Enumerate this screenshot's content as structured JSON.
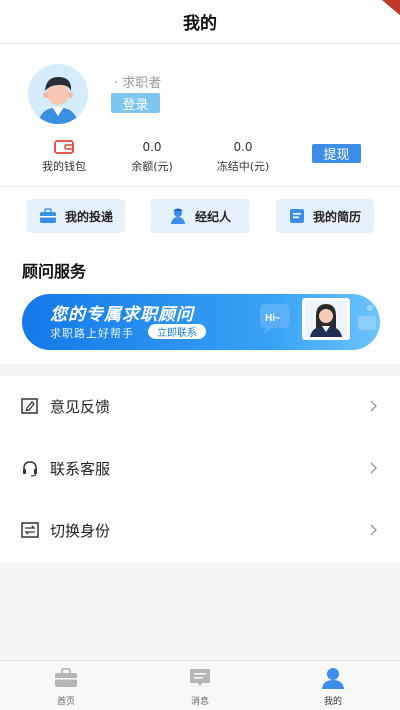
{
  "header": {
    "title": "我的"
  },
  "profile": {
    "role": "· 求职者",
    "login_label": "登录",
    "wallet_label": "我的钱包",
    "balance_value": "0.0",
    "balance_label": "余额(元)",
    "frozen_value": "0.0",
    "frozen_label": "冻结中(元)",
    "withdraw_label": "提现"
  },
  "quick_actions": [
    {
      "label": "我的投递",
      "icon": "briefcase-icon"
    },
    {
      "label": "经纪人",
      "icon": "agent-icon"
    },
    {
      "label": "我的简历",
      "icon": "resume-icon"
    }
  ],
  "consultant": {
    "section_title": "顾问服务",
    "banner_title": "您的专属求职顾问",
    "banner_subtitle": "求职路上好帮手",
    "contact_label": "立即联系",
    "bubble_text": "Hi~"
  },
  "menu": [
    {
      "label": "意见反馈",
      "icon": "feedback-icon"
    },
    {
      "label": "联系客服",
      "icon": "headset-icon"
    },
    {
      "label": "切换身份",
      "icon": "switch-identity-icon"
    }
  ],
  "tabbar": {
    "home_label": "首页",
    "messages_label": "消息",
    "me_label": "我的",
    "active": "我的"
  },
  "colors": {
    "accent": "#3d8ee8",
    "login_button": "#7cc6f0",
    "quick_button_bg": "#e5f1fd",
    "banner_start": "#1478e8",
    "banner_end": "#6cc4fb"
  }
}
